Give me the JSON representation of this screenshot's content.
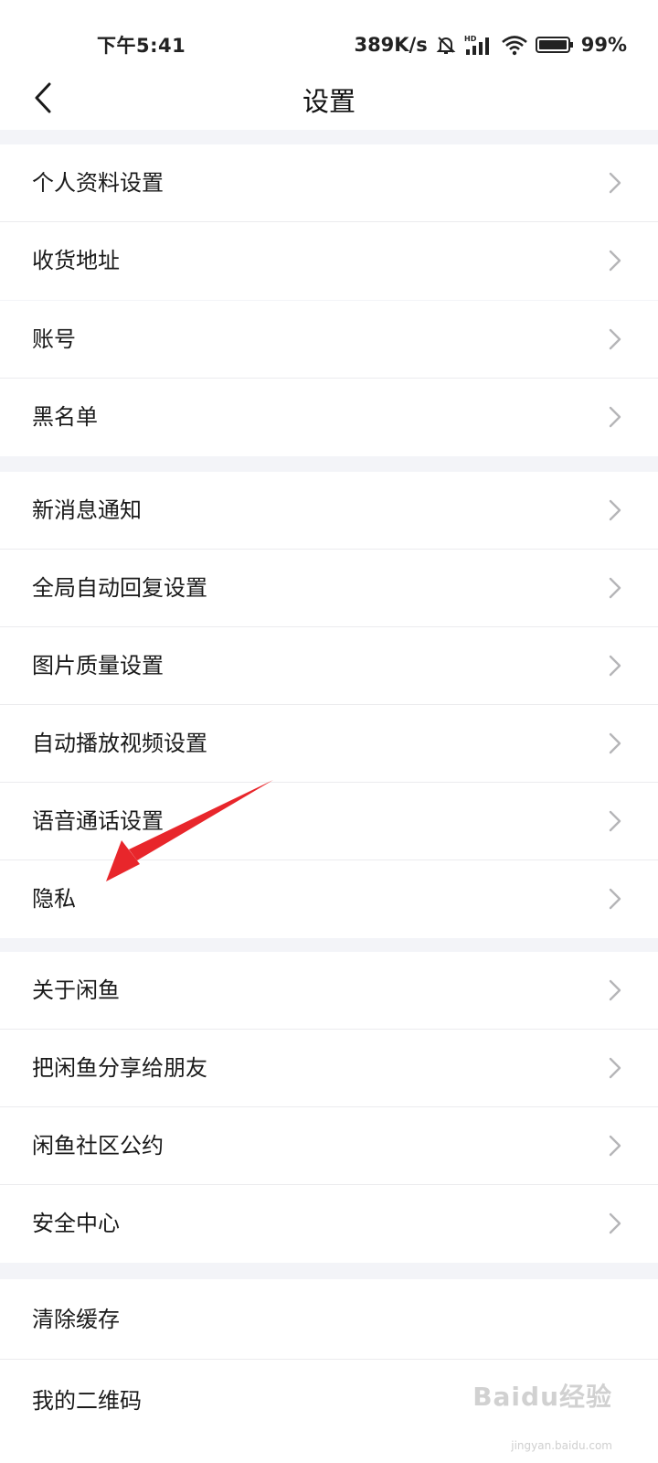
{
  "status_bar": {
    "time": "下午5:41",
    "net_speed": "389K/s",
    "battery": "99%",
    "icons": [
      "bell-off-icon",
      "hd-signal-icon",
      "wifi-icon",
      "battery-icon"
    ]
  },
  "nav": {
    "title": "设置",
    "back_icon": "back-chevron-icon"
  },
  "groups": [
    {
      "items": [
        "个人资料设置",
        "收货地址"
      ]
    },
    {
      "items": [
        "账号",
        "黑名单"
      ]
    },
    {
      "items": [
        "新消息通知",
        "全局自动回复设置",
        "图片质量设置",
        "自动播放视频设置",
        "语音通话设置",
        "隐私"
      ]
    },
    {
      "items": [
        "关于闲鱼",
        "把闲鱼分享给朋友",
        "闲鱼社区公约",
        "安全中心"
      ]
    },
    {
      "items": [
        "清除缓存",
        "我的二维码"
      ]
    }
  ],
  "annotation": {
    "color": "#e8262b",
    "target": "隐私"
  },
  "watermark": {
    "text": "Baidu经验",
    "sub": "jingyan.baidu.com"
  },
  "colors": {
    "background": "#f3f4f8",
    "row": "#ffffff",
    "chevron": "#b5b5b8"
  }
}
